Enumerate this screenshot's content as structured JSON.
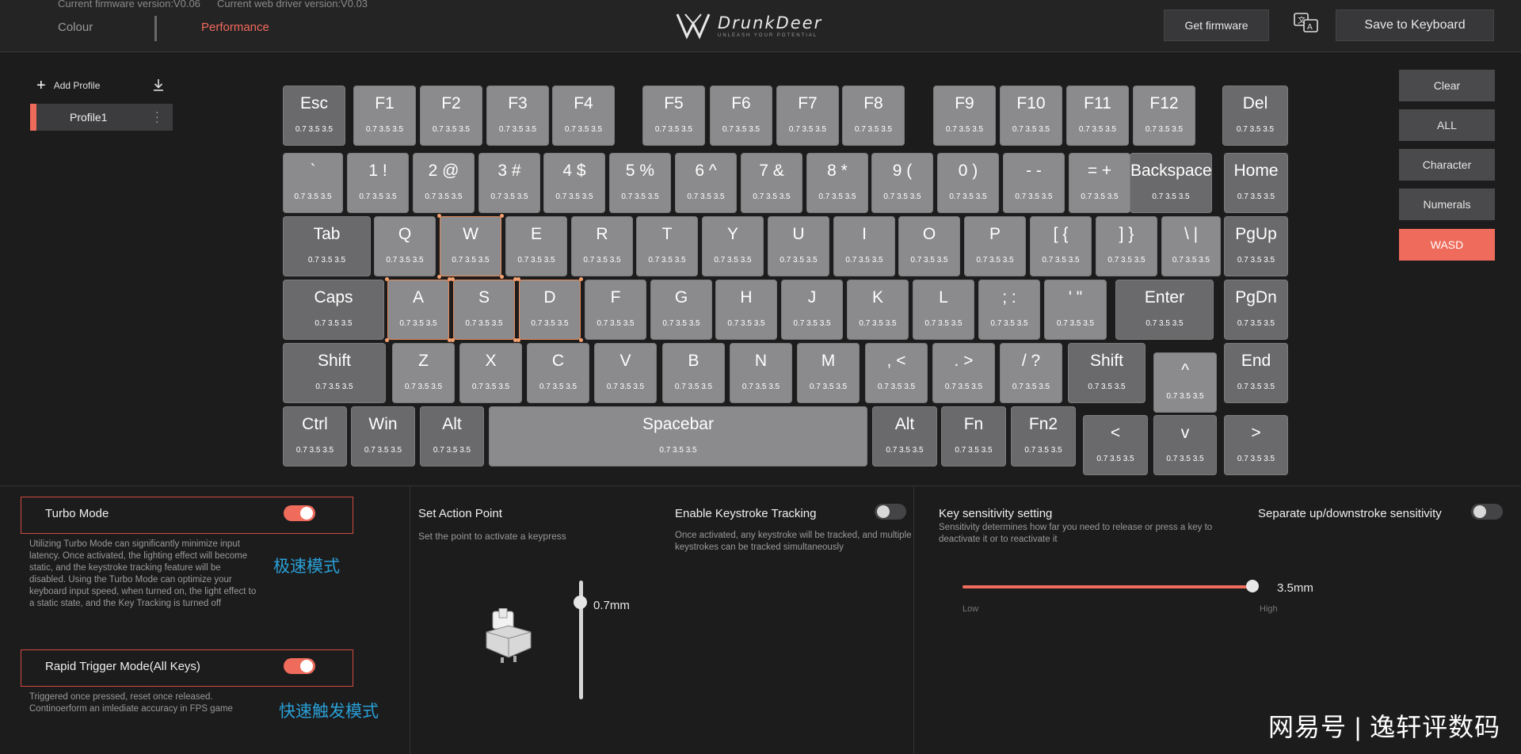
{
  "header": {
    "firmware_version": "Current firmware version:V0.06",
    "web_driver_version": "Current web driver version:V0.03",
    "tabs": [
      {
        "label": "Colour"
      },
      {
        "label": "Performance"
      }
    ],
    "logo_text": "DrunkDeer",
    "logo_tagline": "UNLEASH YOUR POTENTIAL",
    "get_firmware": "Get firmware",
    "save_to_keyboard": "Save to Keyboard",
    "language_icon": "language-icon"
  },
  "profiles": {
    "add_label": "Add Profile",
    "items": [
      {
        "label": "Profile1"
      }
    ]
  },
  "filters": [
    {
      "label": "Clear"
    },
    {
      "label": "ALL"
    },
    {
      "label": "Character"
    },
    {
      "label": "Numerals"
    },
    {
      "label": "WASD",
      "active": true
    }
  ],
  "keyboard": {
    "default_values": "0.7  3.5  3.5",
    "rows": [
      [
        "Esc",
        "F1",
        "F2",
        "F3",
        "F4",
        "F5",
        "F6",
        "F7",
        "F8",
        "F9",
        "F10",
        "F11",
        "F12",
        "Del"
      ],
      [
        "` ",
        "1 !",
        "2 @",
        "3 #",
        "4 $",
        "5 %",
        "6 ^",
        "7 &",
        "8 *",
        "9 (",
        "0 )",
        "- -",
        "= +",
        "Backspace",
        "Home"
      ],
      [
        "Tab",
        "Q",
        "W",
        "E",
        "R",
        "T",
        "Y",
        "U",
        "I",
        "O",
        "P",
        "[ {",
        "] }",
        "\\ |",
        "PgUp"
      ],
      [
        "Caps",
        "A",
        "S",
        "D",
        "F",
        "G",
        "H",
        "J",
        "K",
        "L",
        "; :",
        "' \"",
        "Enter",
        "PgDn"
      ],
      [
        "Shift",
        "Z",
        "X",
        "C",
        "V",
        "B",
        "N",
        "M",
        ", <",
        ". >",
        "/ ?",
        "Shift",
        "^",
        "End"
      ],
      [
        "Ctrl",
        "Win",
        "Alt",
        "Spacebar",
        "Alt",
        "Fn",
        "Fn2",
        "<",
        "v",
        ">"
      ]
    ],
    "selected_keys": [
      "W",
      "A",
      "S",
      "D"
    ]
  },
  "modes": {
    "turbo": {
      "title": "Turbo Mode",
      "enabled": true,
      "description": "Utilizing Turbo Mode can significantly minimize input latency. Once activated, the lighting effect will become static, and the keystroke tracking feature will be disabled. Using the Turbo Mode can optimize your keyboard input speed, when turned on, the light effect to a static state, and the Key Tracking is turned off",
      "cn_label": "极速模式"
    },
    "rapid_trigger": {
      "title": "Rapid Trigger Mode(All Keys)",
      "enabled": true,
      "description": "Triggered once pressed, reset once released. Continoerform an imlediate accuracy in FPS game",
      "cn_label": "快速触发模式"
    }
  },
  "action_point": {
    "title": "Set Action Point",
    "subtitle": "Set the point to activate a keypress",
    "value": "0.7mm",
    "level": 0.14
  },
  "keystroke_tracking": {
    "title": "Enable Keystroke Tracking",
    "enabled": false,
    "description": "Once activated, any keystroke will be tracked, and multiple keystrokes can be tracked simultaneously"
  },
  "sensitivity": {
    "title": "Key sensitivity setting",
    "description": "Sensitivity determines how far you need to release or press a key to deactivate it or to reactivate it",
    "value": "3.5mm",
    "level": 1.0,
    "low_label": "Low",
    "high_label": "High"
  },
  "separate_sensitivity": {
    "title": "Separate up/downstroke sensitivity",
    "enabled": false
  },
  "watermark": "网易号 | 逸轩评数码",
  "colors": {
    "accent": "#ef6b5b",
    "key": "#8b8b8d",
    "cn_label": "#2aa0d6"
  }
}
